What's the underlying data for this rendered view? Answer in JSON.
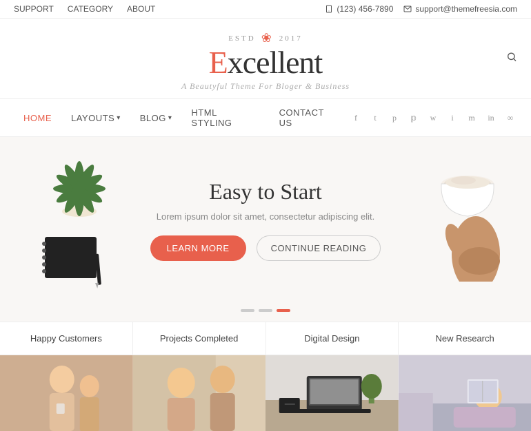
{
  "topbar": {
    "links": [
      "SUPPORT",
      "CATEGORY",
      "ABOUT"
    ],
    "phone": "(123) 456-7890",
    "email": "support@themefreesia.com"
  },
  "brand": {
    "estd_label": "ESTD",
    "estd_year": "2017",
    "logo_text": "xcellent",
    "logo_first": "E",
    "tagline": "A Beautyful Theme For Bloger & Business"
  },
  "nav": {
    "links": [
      {
        "label": "HOME",
        "active": true,
        "has_chevron": false
      },
      {
        "label": "LAYOUTS",
        "active": false,
        "has_chevron": true
      },
      {
        "label": "BLOG",
        "active": false,
        "has_chevron": true
      },
      {
        "label": "HTML STYLING",
        "active": false,
        "has_chevron": false
      },
      {
        "label": "CONTACT US",
        "active": false,
        "has_chevron": false
      }
    ],
    "social_icons": [
      "f",
      "t",
      "p",
      "p",
      "w",
      "i",
      "m",
      "in",
      "∞"
    ]
  },
  "hero": {
    "title": "Easy to Start",
    "description": "Lorem ipsum dolor sit amet, consectetur adipiscing elit.",
    "btn_learn": "LEARN MORE",
    "btn_continue": "CONTINUE READING"
  },
  "slider_dots": [
    {
      "active": false
    },
    {
      "active": false
    },
    {
      "active": true
    }
  ],
  "stats": [
    "Happy Customers",
    "Projects Completed",
    "Digital Design",
    "New Research"
  ],
  "photos": [
    {
      "alt": "happy customers photo",
      "bg": "#e8d5c9"
    },
    {
      "alt": "projects completed photo",
      "bg": "#d9c9b8"
    },
    {
      "alt": "digital design photo",
      "bg": "#c9d0cc"
    },
    {
      "alt": "new research photo",
      "bg": "#c5c5cc"
    }
  ],
  "colors": {
    "accent": "#e8604c",
    "text_dark": "#333",
    "text_mid": "#555",
    "text_light": "#aaa"
  }
}
